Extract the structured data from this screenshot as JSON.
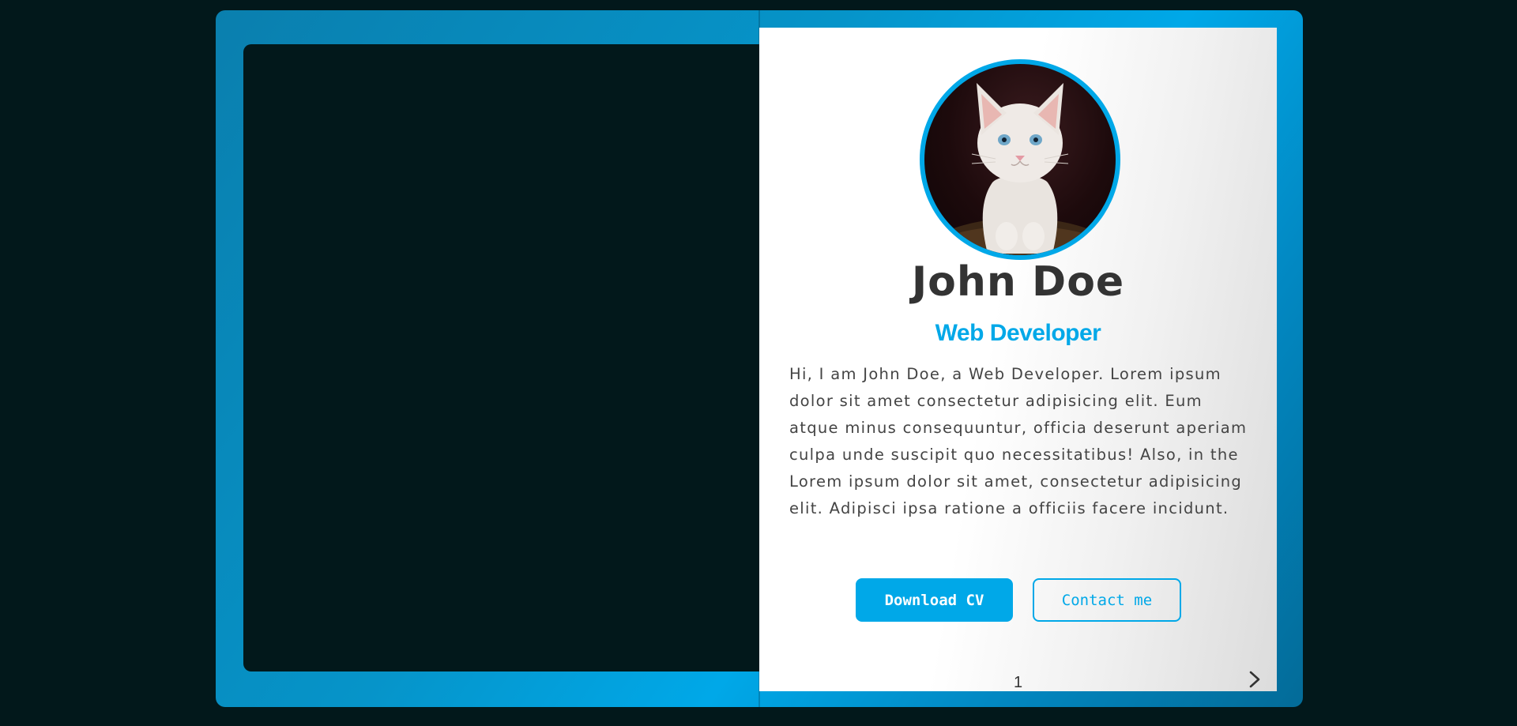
{
  "profile": {
    "name": "John Doe",
    "role": "Web Developer",
    "bio": "Hi, I am John Doe, a Web Developer. Lorem ipsum dolor sit amet consectetur adipisicing elit. Eum atque minus consequuntur, officia deserunt aperiam culpa unde suscipit quo necessitatibus! Also, in the Lorem ipsum dolor sit amet, consectetur adipisicing elit. Adipisci ipsa ratione a officiis facere incidunt."
  },
  "actions": {
    "download_label": "Download CV",
    "contact_label": "Contact me"
  },
  "pagination": {
    "page_number": "1",
    "next_icon": "chevron-right-icon"
  },
  "colors": {
    "background": "#02181b",
    "accent": "#00a8e8",
    "heading": "#333333",
    "body_text": "#444444"
  }
}
